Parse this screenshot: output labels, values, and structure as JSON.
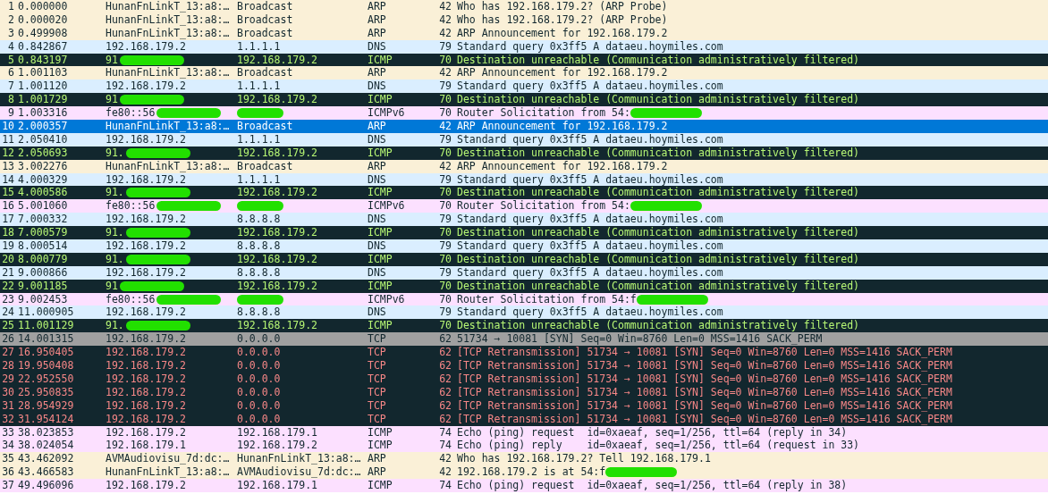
{
  "packets": [
    {
      "no": "1",
      "time": "0.000000",
      "source": "HunanFnLinkT_13:a8:…",
      "destination": "Broadcast",
      "protocol": "ARP",
      "length": "42",
      "info": "Who has 192.168.179.2? (ARP Probe)",
      "kind": "arp",
      "selected": false
    },
    {
      "no": "2",
      "time": "0.000020",
      "source": "HunanFnLinkT_13:a8:…",
      "destination": "Broadcast",
      "protocol": "ARP",
      "length": "42",
      "info": "Who has 192.168.179.2? (ARP Probe)",
      "kind": "arp",
      "selected": false
    },
    {
      "no": "3",
      "time": "0.499908",
      "source": "HunanFnLinkT_13:a8:…",
      "destination": "Broadcast",
      "protocol": "ARP",
      "length": "42",
      "info": "ARP Announcement for 192.168.179.2",
      "kind": "arp",
      "selected": false
    },
    {
      "no": "4",
      "time": "0.842867",
      "source": "192.168.179.2",
      "destination": "1.1.1.1",
      "protocol": "DNS",
      "length": "79",
      "info": "Standard query 0x3ff5 A dataeu.hoymiles.com",
      "kind": "dns",
      "selected": false
    },
    {
      "no": "5",
      "time": "0.843197",
      "source": "91",
      "destination": "192.168.179.2",
      "protocol": "ICMP",
      "length": "70",
      "info": "Destination unreachable (Communication administratively filtered)",
      "kind": "icmp_error",
      "selected": false,
      "source_redacted": true
    },
    {
      "no": "6",
      "time": "1.001103",
      "source": "HunanFnLinkT_13:a8:…",
      "destination": "Broadcast",
      "protocol": "ARP",
      "length": "42",
      "info": "ARP Announcement for 192.168.179.2",
      "kind": "arp",
      "selected": false
    },
    {
      "no": "7",
      "time": "1.001120",
      "source": "192.168.179.2",
      "destination": "1.1.1.1",
      "protocol": "DNS",
      "length": "79",
      "info": "Standard query 0x3ff5 A dataeu.hoymiles.com",
      "kind": "dns",
      "selected": false
    },
    {
      "no": "8",
      "time": "1.001729",
      "source": "91",
      "destination": "192.168.179.2",
      "protocol": "ICMP",
      "length": "70",
      "info": "Destination unreachable (Communication administratively filtered)",
      "kind": "icmp_error",
      "selected": false,
      "source_redacted": true
    },
    {
      "no": "9",
      "time": "1.003316",
      "source": "fe80::56",
      "protocol": "ICMPv6",
      "length": "70",
      "info": "Router Solicitation from 54:",
      "kind": "icmpv6",
      "selected": false,
      "source_redacted": true,
      "destination_redacted": true,
      "info_redacted": true
    },
    {
      "no": "10",
      "time": "2.000357",
      "source": "HunanFnLinkT_13:a8:…",
      "destination": "Broadcast",
      "protocol": "ARP",
      "length": "42",
      "info": "ARP Announcement for 192.168.179.2",
      "kind": "arp",
      "selected": true
    },
    {
      "no": "11",
      "time": "2.050410",
      "source": "192.168.179.2",
      "destination": "1.1.1.1",
      "protocol": "DNS",
      "length": "79",
      "info": "Standard query 0x3ff5 A dataeu.hoymiles.com",
      "kind": "dns",
      "selected": false
    },
    {
      "no": "12",
      "time": "2.050693",
      "source": "91.",
      "destination": "192.168.179.2",
      "protocol": "ICMP",
      "length": "70",
      "info": "Destination unreachable (Communication administratively filtered)",
      "kind": "icmp_error",
      "selected": false,
      "source_redacted": true
    },
    {
      "no": "13",
      "time": "3.002276",
      "source": "HunanFnLinkT_13:a8:…",
      "destination": "Broadcast",
      "protocol": "ARP",
      "length": "42",
      "info": "ARP Announcement for 192.168.179.2",
      "kind": "arp",
      "selected": false
    },
    {
      "no": "14",
      "time": "4.000329",
      "source": "192.168.179.2",
      "destination": "1.1.1.1",
      "protocol": "DNS",
      "length": "79",
      "info": "Standard query 0x3ff5 A dataeu.hoymiles.com",
      "kind": "dns",
      "selected": false
    },
    {
      "no": "15",
      "time": "4.000586",
      "source": "91.",
      "destination": "192.168.179.2",
      "protocol": "ICMP",
      "length": "70",
      "info": "Destination unreachable (Communication administratively filtered)",
      "kind": "icmp_error",
      "selected": false,
      "source_redacted": true
    },
    {
      "no": "16",
      "time": "5.001060",
      "source": "fe80::56",
      "protocol": "ICMPv6",
      "length": "70",
      "info": "Router Solicitation from 54:",
      "kind": "icmpv6",
      "selected": false,
      "source_redacted": true,
      "destination_redacted": true,
      "info_redacted": true
    },
    {
      "no": "17",
      "time": "7.000332",
      "source": "192.168.179.2",
      "destination": "8.8.8.8",
      "protocol": "DNS",
      "length": "79",
      "info": "Standard query 0x3ff5 A dataeu.hoymiles.com",
      "kind": "dns",
      "selected": false
    },
    {
      "no": "18",
      "time": "7.000579",
      "source": "91.",
      "destination": "192.168.179.2",
      "protocol": "ICMP",
      "length": "70",
      "info": "Destination unreachable (Communication administratively filtered)",
      "kind": "icmp_error",
      "selected": false,
      "source_redacted": true
    },
    {
      "no": "19",
      "time": "8.000514",
      "source": "192.168.179.2",
      "destination": "8.8.8.8",
      "protocol": "DNS",
      "length": "79",
      "info": "Standard query 0x3ff5 A dataeu.hoymiles.com",
      "kind": "dns",
      "selected": false
    },
    {
      "no": "20",
      "time": "8.000779",
      "source": "91.",
      "destination": "192.168.179.2",
      "protocol": "ICMP",
      "length": "70",
      "info": "Destination unreachable (Communication administratively filtered)",
      "kind": "icmp_error",
      "selected": false,
      "source_redacted": true
    },
    {
      "no": "21",
      "time": "9.000866",
      "source": "192.168.179.2",
      "destination": "8.8.8.8",
      "protocol": "DNS",
      "length": "79",
      "info": "Standard query 0x3ff5 A dataeu.hoymiles.com",
      "kind": "dns",
      "selected": false
    },
    {
      "no": "22",
      "time": "9.001185",
      "source": "91",
      "destination": "192.168.179.2",
      "protocol": "ICMP",
      "length": "70",
      "info": "Destination unreachable (Communication administratively filtered)",
      "kind": "icmp_error",
      "selected": false,
      "source_redacted": true
    },
    {
      "no": "23",
      "time": "9.002453",
      "source": "fe80::56",
      "protocol": "ICMPv6",
      "length": "70",
      "info": "Router Solicitation from 54:f",
      "kind": "icmpv6",
      "selected": false,
      "source_redacted": true,
      "destination_redacted": true,
      "info_redacted": true
    },
    {
      "no": "24",
      "time": "11.000905",
      "source": "192.168.179.2",
      "destination": "8.8.8.8",
      "protocol": "DNS",
      "length": "79",
      "info": "Standard query 0x3ff5 A dataeu.hoymiles.com",
      "kind": "dns",
      "selected": false
    },
    {
      "no": "25",
      "time": "11.001129",
      "source": "91.",
      "destination": "192.168.179.2",
      "protocol": "ICMP",
      "length": "70",
      "info": "Destination unreachable (Communication administratively filtered)",
      "kind": "icmp_error",
      "selected": false,
      "source_redacted": true
    },
    {
      "no": "26",
      "time": "14.001315",
      "source": "192.168.179.2",
      "destination": "0.0.0.0",
      "protocol": "TCP",
      "length": "62",
      "info": "51734 → 10081 [SYN] Seq=0 Win=8760 Len=0 MSS=1416 SACK_PERM",
      "kind": "tcp_syn",
      "selected": false
    },
    {
      "no": "27",
      "time": "16.950405",
      "source": "192.168.179.2",
      "destination": "0.0.0.0",
      "protocol": "TCP",
      "length": "62",
      "info": "[TCP Retransmission] 51734 → 10081 [SYN] Seq=0 Win=8760 Len=0 MSS=1416 SACK_PERM",
      "kind": "tcp_bad",
      "selected": false
    },
    {
      "no": "28",
      "time": "19.950408",
      "source": "192.168.179.2",
      "destination": "0.0.0.0",
      "protocol": "TCP",
      "length": "62",
      "info": "[TCP Retransmission] 51734 → 10081 [SYN] Seq=0 Win=8760 Len=0 MSS=1416 SACK_PERM",
      "kind": "tcp_bad",
      "selected": false
    },
    {
      "no": "29",
      "time": "22.952550",
      "source": "192.168.179.2",
      "destination": "0.0.0.0",
      "protocol": "TCP",
      "length": "62",
      "info": "[TCP Retransmission] 51734 → 10081 [SYN] Seq=0 Win=8760 Len=0 MSS=1416 SACK_PERM",
      "kind": "tcp_bad",
      "selected": false
    },
    {
      "no": "30",
      "time": "25.950835",
      "source": "192.168.179.2",
      "destination": "0.0.0.0",
      "protocol": "TCP",
      "length": "62",
      "info": "[TCP Retransmission] 51734 → 10081 [SYN] Seq=0 Win=8760 Len=0 MSS=1416 SACK_PERM",
      "kind": "tcp_bad",
      "selected": false
    },
    {
      "no": "31",
      "time": "28.954929",
      "source": "192.168.179.2",
      "destination": "0.0.0.0",
      "protocol": "TCP",
      "length": "62",
      "info": "[TCP Retransmission] 51734 → 10081 [SYN] Seq=0 Win=8760 Len=0 MSS=1416 SACK_PERM",
      "kind": "tcp_bad",
      "selected": false
    },
    {
      "no": "32",
      "time": "31.954124",
      "source": "192.168.179.2",
      "destination": "0.0.0.0",
      "protocol": "TCP",
      "length": "62",
      "info": "[TCP Retransmission] 51734 → 10081 [SYN] Seq=0 Win=8760 Len=0 MSS=1416 SACK_PERM",
      "kind": "tcp_bad",
      "selected": false
    },
    {
      "no": "33",
      "time": "38.023853",
      "source": "192.168.179.2",
      "destination": "192.168.179.1",
      "protocol": "ICMP",
      "length": "74",
      "info": "Echo (ping) request  id=0xaeaf, seq=1/256, ttl=64 (reply in 34)",
      "kind": "icmp",
      "selected": false
    },
    {
      "no": "34",
      "time": "38.024054",
      "source": "192.168.179.1",
      "destination": "192.168.179.2",
      "protocol": "ICMP",
      "length": "74",
      "info": "Echo (ping) reply    id=0xaeaf, seq=1/256, ttl=64 (request in 33)",
      "kind": "icmp",
      "selected": false
    },
    {
      "no": "35",
      "time": "43.462092",
      "source": "AVMAudiovisu_7d:dc:…",
      "destination": "HunanFnLinkT_13:a8:…",
      "protocol": "ARP",
      "length": "42",
      "info": "Who has 192.168.179.2? Tell 192.168.179.1",
      "kind": "arp",
      "selected": false
    },
    {
      "no": "36",
      "time": "43.466583",
      "source": "HunanFnLinkT_13:a8:…",
      "destination": "AVMAudiovisu_7d:dc:…",
      "protocol": "ARP",
      "length": "42",
      "info": "192.168.179.2 is at 54:f",
      "kind": "arp",
      "selected": false,
      "info_redacted": true
    },
    {
      "no": "37",
      "time": "49.496096",
      "source": "192.168.179.2",
      "destination": "192.168.179.1",
      "protocol": "ICMP",
      "length": "74",
      "info": "Echo (ping) request  id=0xaeaf, seq=1/256, ttl=64 (reply in 38)",
      "kind": "icmp",
      "selected": false
    }
  ]
}
